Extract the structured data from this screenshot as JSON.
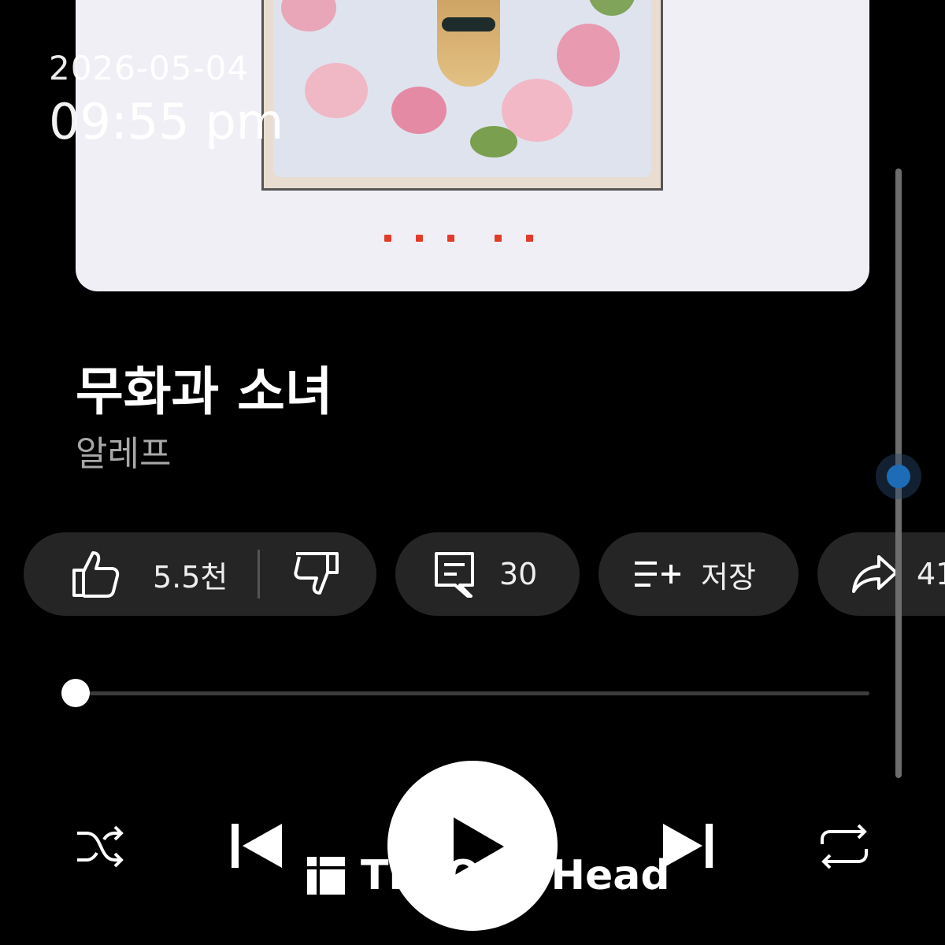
{
  "status": {
    "date": "2026-05-04",
    "time": "09:55 pm"
  },
  "track": {
    "title": "무화과 소녀",
    "artist": "알레프"
  },
  "actions": {
    "like_count": "5.5천",
    "comment_count": "30",
    "save_label": "저장",
    "share_count": "41"
  },
  "playback": {
    "progress_fraction": 0.0,
    "shuffle": "shuffle-icon",
    "repeat": "repeat-icon"
  },
  "icons": [
    "thumbs-up-icon",
    "thumbs-down-icon",
    "comment-icon",
    "add-to-playlist-icon",
    "share-icon",
    "shuffle-icon",
    "previous-icon",
    "play-icon",
    "next-icon",
    "repeat-icon"
  ],
  "watermark": {
    "text": "TheQoo Head"
  },
  "colors": {
    "background": "#000000",
    "pill": "#252525",
    "accent_dots": "#e33b2a",
    "scroll_thumb": "#1e6cb5"
  }
}
